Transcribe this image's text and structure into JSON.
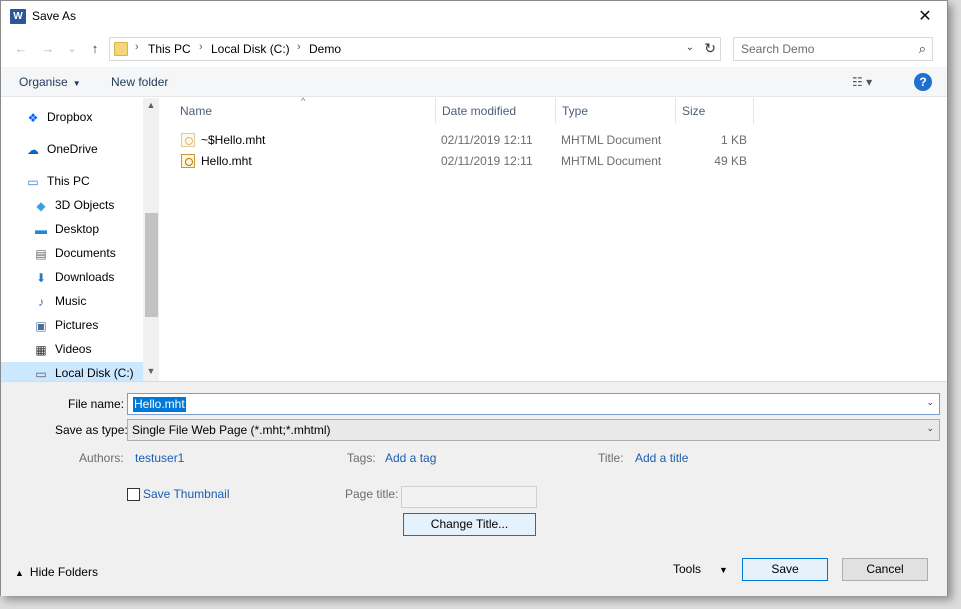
{
  "window": {
    "title": "Save As",
    "app_icon_glyph": "W",
    "close_glyph": "✕"
  },
  "nav": {
    "back_glyph": "←",
    "forward_glyph": "→",
    "recent_glyph": "⌄",
    "up_glyph": "↑"
  },
  "address": {
    "crumbs": [
      "This PC",
      "Local Disk (C:)",
      "Demo"
    ],
    "sep_glyph": "›",
    "dropdown_glyph": "⌄",
    "refresh_glyph": "↻"
  },
  "search": {
    "placeholder": "Search Demo",
    "icon_glyph": "⌕"
  },
  "toolbar": {
    "organise_label": "Organise",
    "new_folder_label": "New folder",
    "caret": "▼",
    "view_glyph": "☷ ▾",
    "help_glyph": "?"
  },
  "sidebar": {
    "items": [
      {
        "label": "Dropbox",
        "icon": "dropbox-icon",
        "glyph": "❖",
        "color": "#0061fe"
      },
      {
        "label": "OneDrive",
        "icon": "onedrive-icon",
        "glyph": "☁",
        "color": "#0a64c8"
      },
      {
        "label": "This PC",
        "icon": "computer-icon",
        "glyph": "▭",
        "color": "#2a7fd4"
      },
      {
        "label": "3D Objects",
        "icon": "cube-icon",
        "glyph": "◆",
        "color": "#3aa0e0"
      },
      {
        "label": "Desktop",
        "icon": "desktop-icon",
        "glyph": "▬",
        "color": "#1f86d9"
      },
      {
        "label": "Documents",
        "icon": "documents-icon",
        "glyph": "▤",
        "color": "#666666"
      },
      {
        "label": "Downloads",
        "icon": "download-icon",
        "glyph": "⬇",
        "color": "#2e74c9"
      },
      {
        "label": "Music",
        "icon": "music-icon",
        "glyph": "♪",
        "color": "#2e74c9"
      },
      {
        "label": "Pictures",
        "icon": "pictures-icon",
        "glyph": "▣",
        "color": "#4a6f93"
      },
      {
        "label": "Videos",
        "icon": "videos-icon",
        "glyph": "▦",
        "color": "#333333"
      },
      {
        "label": "Local Disk (C:)",
        "icon": "disk-icon",
        "glyph": "▭",
        "color": "#555555"
      }
    ],
    "scroll_up": "▲",
    "scroll_down": "▼"
  },
  "filelist": {
    "columns": [
      "Name",
      "Date modified",
      "Type",
      "Size"
    ],
    "sort_glyph": "^",
    "rows": [
      {
        "name": "~$Hello.mht",
        "date": "02/11/2019 12:11",
        "type": "MHTML Document",
        "size": "1 KB"
      },
      {
        "name": "Hello.mht",
        "date": "02/11/2019 12:11",
        "type": "MHTML Document",
        "size": "49 KB"
      }
    ]
  },
  "form": {
    "file_name_label": "File name:",
    "file_name_value": "Hello.mht",
    "save_type_label": "Save as type:",
    "save_type_value": "Single File Web Page (*.mht;*.mhtml)",
    "authors_label": "Authors:",
    "authors_value": "testuser1",
    "tags_label": "Tags:",
    "tags_value": "Add a tag",
    "title_label": "Title:",
    "title_value": "Add a title",
    "save_thumbnail_label": "Save Thumbnail",
    "page_title_label": "Page title:",
    "change_title_label": "Change Title...",
    "dropdown_glyph": "⌄"
  },
  "footer": {
    "hide_folders_label": "Hide Folders",
    "hide_folders_glyph": "▲",
    "tools_label": "Tools",
    "tools_glyph": "▼",
    "save_label": "Save",
    "cancel_label": "Cancel"
  }
}
